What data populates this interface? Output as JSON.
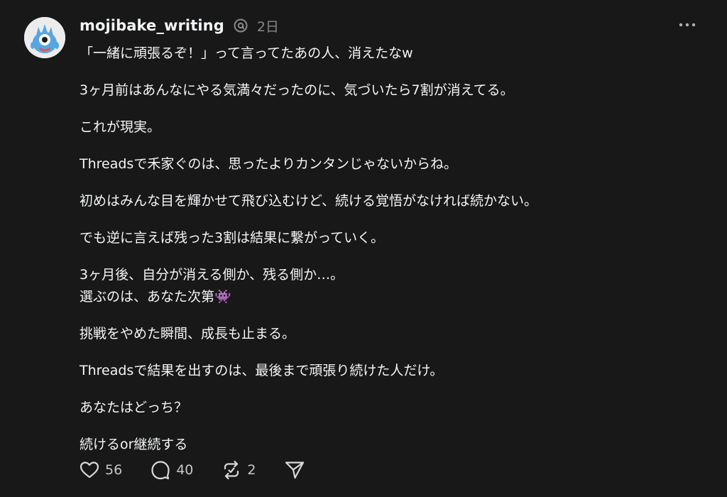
{
  "post": {
    "username": "mojibake_writing",
    "time": "2日",
    "paragraphs": [
      [
        "「一緒に頑張るぞ！」って言ってたあの人、消えたなw"
      ],
      [
        "3ヶ月前はあんなにやる気満々だったのに、気づいたら7割が消えてる。"
      ],
      [
        "これが現実。"
      ],
      [
        "Threadsで禾家ぐのは、思ったよりカンタンじゃないからね。"
      ],
      [
        "初めはみんな目を輝かせて飛び込むけど、続ける覚悟がなければ続かない。"
      ],
      [
        "でも逆に言えば残った3割は結果に繋がっていく。"
      ],
      [
        "3ヶ月後、自分が消える側か、残る側か…。",
        "選ぶのは、あなた次第👾"
      ],
      [
        "挑戦をやめた瞬間、成長も止まる。"
      ],
      [
        "Threadsで結果を出すのは、最後まで頑張り続けた人だけ。"
      ],
      [
        "あなたはどっち？"
      ],
      [
        "続けるor継続する"
      ]
    ]
  },
  "actions": {
    "like_count": "56",
    "comment_count": "40",
    "repost_count": "2"
  },
  "icons": {
    "avatar": "monster-avatar",
    "verified": "threads-logo-icon",
    "more": "more-horizontal-icon",
    "like": "heart-icon",
    "comment": "comment-bubble-icon",
    "repost": "repost-icon",
    "share": "send-icon"
  },
  "colors": {
    "background": "#181818",
    "text": "#f3f5f7",
    "muted": "#8a8a8a",
    "avatar_monster": "#58a6e0"
  }
}
